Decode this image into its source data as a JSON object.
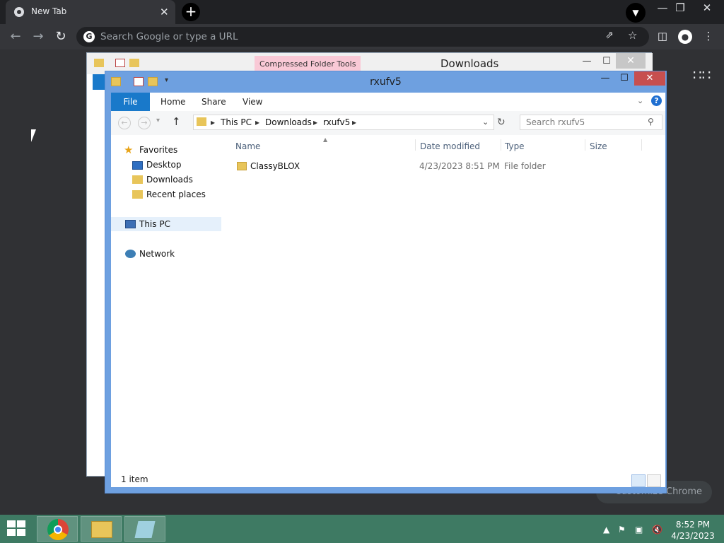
{
  "browser": {
    "tab_title": "New Tab",
    "tab_close": "✕",
    "new_tab": "+",
    "omnibox_placeholder": "Search Google or type a URL",
    "customize_label": "Customize Chrome",
    "window_controls": {
      "minimize": "—",
      "restore": "❐",
      "close": "✕"
    }
  },
  "back_window": {
    "title": "Downloads",
    "context_tab": "Compressed Folder Tools",
    "controls": {
      "minimize": "—",
      "maximize": "☐",
      "close": "✕"
    }
  },
  "explorer": {
    "title": "rxufv5",
    "controls": {
      "minimize": "—",
      "maximize": "☐",
      "close": "✕"
    },
    "ribbon_tabs": {
      "file": "File",
      "home": "Home",
      "share": "Share",
      "view": "View"
    },
    "path": [
      "This PC",
      "Downloads",
      "rxufv5"
    ],
    "search_placeholder": "Search rxufv5",
    "nav": {
      "favorites": "Favorites",
      "desktop": "Desktop",
      "downloads": "Downloads",
      "recent": "Recent places",
      "this_pc": "This PC",
      "network": "Network"
    },
    "columns": {
      "name": "Name",
      "date": "Date modified",
      "type": "Type",
      "size": "Size"
    },
    "files": [
      {
        "name": "ClassyBLOX",
        "date": "4/23/2023 8:51 PM",
        "type": "File folder",
        "size": ""
      }
    ],
    "status": "1 item"
  },
  "taskbar": {
    "time": "8:52 PM",
    "date": "4/23/2023"
  }
}
